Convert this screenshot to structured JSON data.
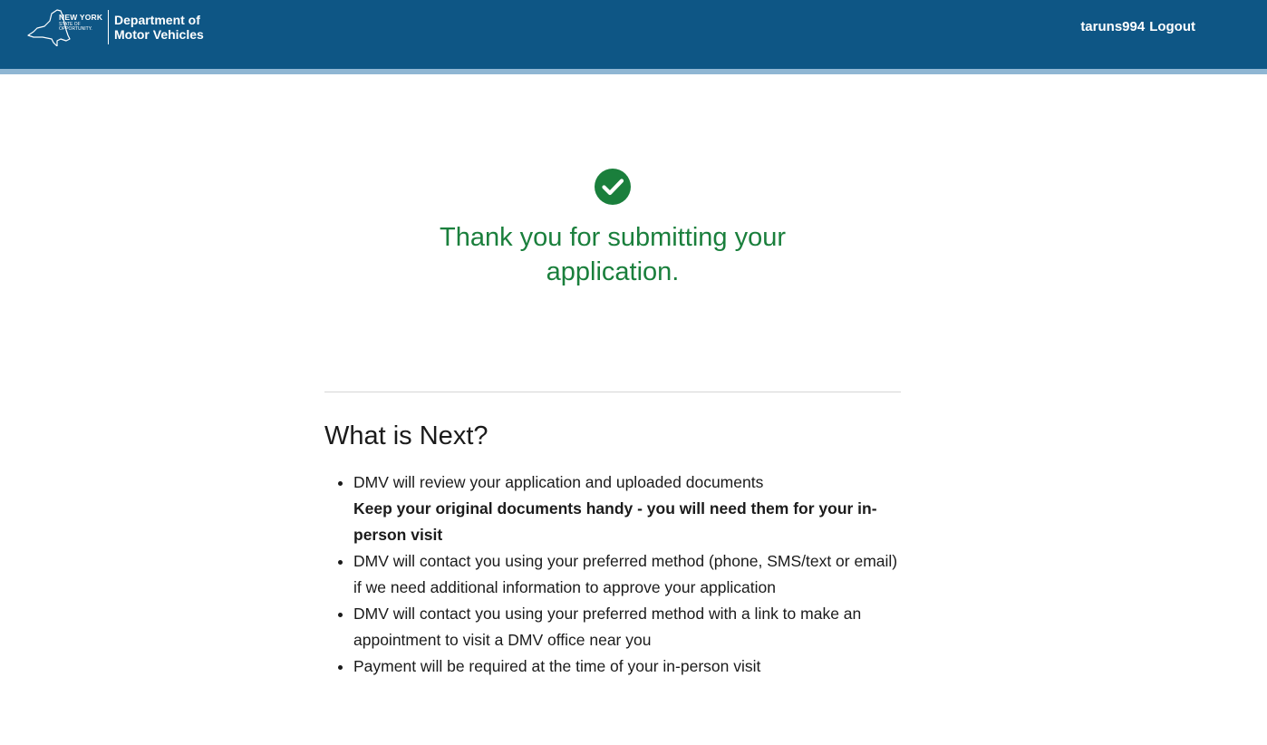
{
  "header": {
    "state_name": "NEW YORK",
    "state_tagline": "STATE OF OPPORTUNITY.",
    "dept_line1": "Department of",
    "dept_line2": "Motor Vehicles",
    "username": "taruns994",
    "logout_label": "Logout"
  },
  "success": {
    "icon": "check-circle-icon",
    "message": "Thank you for submitting your application."
  },
  "next": {
    "title": "What is Next?",
    "items": [
      {
        "text": "DMV will review your application and uploaded documents",
        "note": "Keep your original documents handy - you will need them for your in-person visit"
      },
      {
        "text": "DMV will contact you using your preferred method (phone, SMS/text or email) if we need additional information to approve your application"
      },
      {
        "text": "DMV will contact you using your preferred method with a link to make an appointment to visit a DMV office near you"
      },
      {
        "text": "Payment will be required at the time of your in-person visit"
      }
    ]
  },
  "colors": {
    "header_bg": "#0e5685",
    "header_stripe": "#8fb6d3",
    "success_green": "#1a7f3c"
  }
}
